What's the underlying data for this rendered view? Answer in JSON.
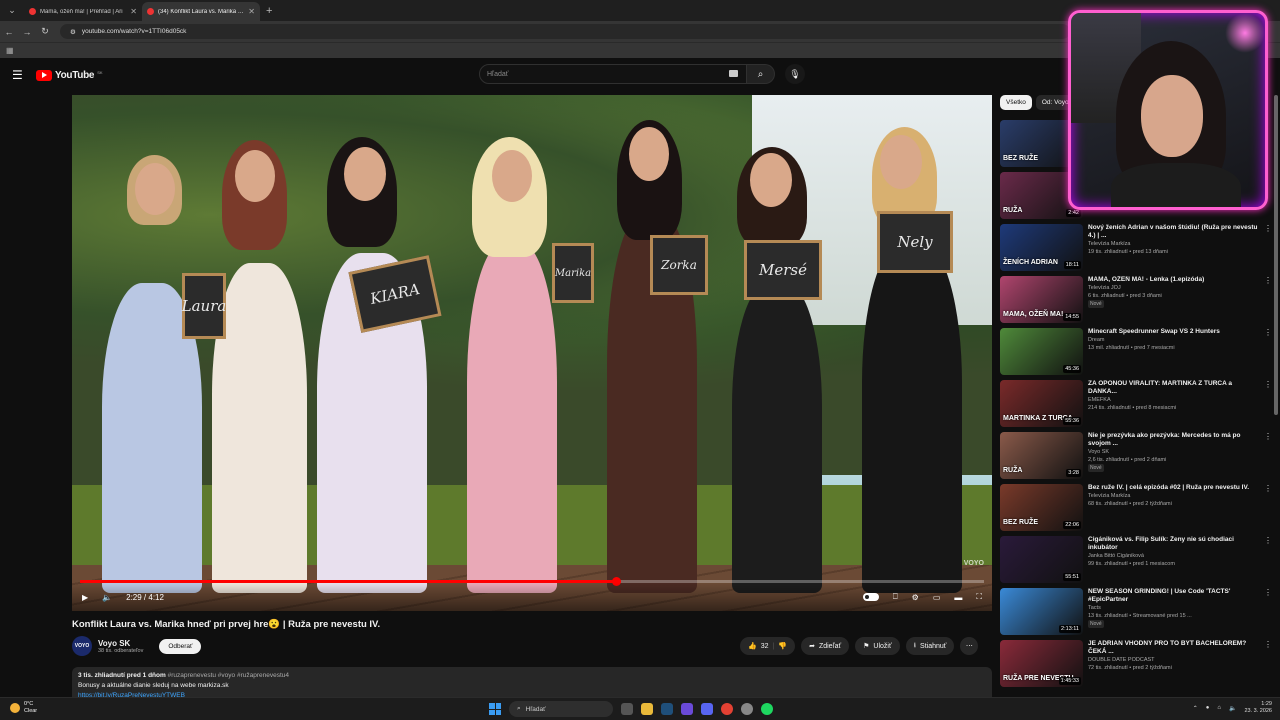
{
  "browser": {
    "tabs": [
      {
        "title": "Mama, ožeň ma! | Prehľad | Ari",
        "active": false
      },
      {
        "title": "(34) Konflikt Laura vs. Marika hn",
        "active": true
      }
    ],
    "url": "youtube.com/watch?v=1TTI06d05ck"
  },
  "youtube": {
    "logo_text": "YouTube",
    "region": "SK",
    "search_placeholder": "Hľadať"
  },
  "player": {
    "watermark": "VOYO",
    "time": "2:29 / 4:12",
    "progress_fraction": 0.593,
    "boards": [
      "Laura",
      "KIARA",
      "Marika",
      "Zorka",
      "Mersé",
      "Nely"
    ]
  },
  "video": {
    "title": "Konflikt Laura vs. Marika hneď pri prvej hre😮 | Ruža pre nevestu IV.",
    "channel": "Voyo SK",
    "avatar_text": "VOYO",
    "subscribers": "38 tis. odberateľov",
    "subscribe_label": "Odberať",
    "likes": "32",
    "share_label": "Zdieľať",
    "save_label": "Uložiť",
    "download_label": "Stiahnuť",
    "desc_stats": "3 tis. zhliadnutí  pred 1 dňom",
    "desc_tags": "#ruzaprenevestu #voyo #ružaprenevestu4",
    "desc_line": "Bonusy a aktuálne dianie sleduj na webe markiza.sk",
    "desc_link": "https://bit.ly/RuzaPreNevestuYTWEB"
  },
  "sidebar": {
    "chips": [
      "Všetko",
      "Od: Voyo"
    ],
    "items": [
      {
        "title": "",
        "channel": "",
        "stats": "",
        "duration": "",
        "thumb_text": "BEZ RUŽE",
        "color": "#2a3d6a",
        "new": false
      },
      {
        "title": "",
        "channel": "",
        "stats": "Nové",
        "duration": "2:42",
        "thumb_text": "RUŽA",
        "color": "#6a2a4a",
        "new": false
      },
      {
        "title": "Nový ženích Adrian v našom štúdiu! (Ruža pre nevestu 4.) | ...",
        "channel": "Televízia Markíza",
        "stats": "19 tis. zhliadnutí • pred 13 dňami",
        "duration": "18:11",
        "thumb_text": "ŽENÍCH ADRIAN",
        "color": "#1e3a7a",
        "new": false
      },
      {
        "title": "MAMA, OŽEŇ MA! - Lenka (1.epizóda)",
        "channel": "Televízia JOJ",
        "stats": "6 tis. zhliadnutí • pred 3 dňami",
        "duration": "14:55",
        "thumb_text": "MAMA, OŽEŇ MA!",
        "color": "#b0456e",
        "new": true
      },
      {
        "title": "Minecraft Speedrunner Swap VS 2 Hunters",
        "channel": "Dream",
        "stats": "13 mil. zhliadnutí • pred 7 mesiacmi",
        "duration": "45:36",
        "thumb_text": "",
        "color": "#4f8a3a",
        "new": false
      },
      {
        "title": "ZA OPONOU VIRALITY: MARTINKA Z TURCA a DANKA...",
        "channel": "EMEFKA",
        "stats": "214 tis. zhliadnutí • pred 8 mesiacmi",
        "duration": "55:36",
        "thumb_text": "MARTINKA Z TURCA",
        "color": "#7a2a2a",
        "new": false
      },
      {
        "title": "Nie je prezývka ako prezývka: Mercedes to má po svojom ...",
        "channel": "Voyo SK",
        "stats": "2,6 tis. zhliadnutí • pred 2 dňami",
        "duration": "3:28",
        "thumb_text": "RUŽA",
        "color": "#8a5a4a",
        "new": true
      },
      {
        "title": "Bez ruže IV. | celá epizóda #02 | Ruža pre nevestu IV.",
        "channel": "Televízia Markíza",
        "stats": "68 tis. zhliadnutí • pred 2 týždňami",
        "duration": "22:06",
        "thumb_text": "BEZ RUŽE",
        "color": "#7a3a2a",
        "new": false
      },
      {
        "title": "Cigániková vs. Filip Sulík: Ženy nie sú chodiaci inkubátor",
        "channel": "Janka Bittó Cigániková",
        "stats": "99 tis. zhliadnutí • pred 1 mesiacom",
        "duration": "55:51",
        "thumb_text": "",
        "color": "#2a1a3a",
        "new": false
      },
      {
        "title": "NEW SEASON GRINDING! | Use Code 'TACTS' #EpicPartner",
        "channel": "Tacts",
        "stats": "13 tis. zhliadnutí • Streamované pred 15 ...",
        "duration": "2:13:11",
        "thumb_text": "",
        "color": "#3a8ad8",
        "new": true
      },
      {
        "title": "JE ADRIAN VHODNÝ PRO TO BÝT BACHELOREM? ČEKÁ ...",
        "channel": "DOUBLE DATE PODCAST",
        "stats": "72 tis. zhliadnutí • pred 2 týždňami",
        "duration": "1:45:33",
        "thumb_text": "RUŽA PRE NEVESTU",
        "color": "#8a2a3a",
        "new": false
      }
    ],
    "new_label": "Nové"
  },
  "taskbar": {
    "temp": "0°C",
    "weather": "Clear",
    "search": "Hľadať",
    "time": "1:29",
    "date": "23. 3. 2026"
  }
}
